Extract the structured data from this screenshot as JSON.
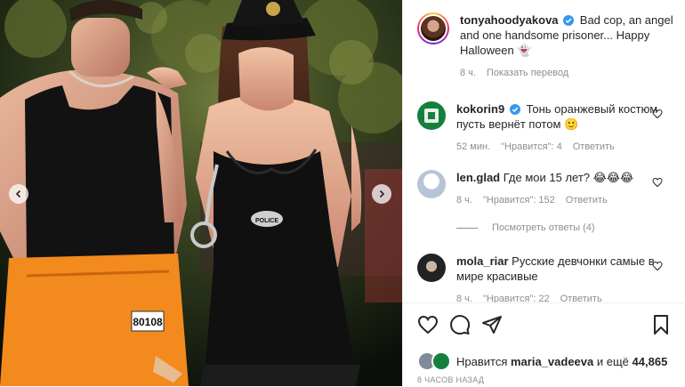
{
  "post": {
    "author": "tonyahoodyakova",
    "caption": "Bad cop, an angel and one handsome prisoner... Happy Halloween",
    "caption_emoji": "👻",
    "age": "8 ч.",
    "translate_label": "Показать перевод"
  },
  "comments": [
    {
      "user": "kokorin9",
      "verified": true,
      "text": "Тонь оранжевый костюм пусть вернёт потом",
      "emoji": "🙂",
      "age": "52 мин.",
      "likes": "\"Нравится\": 4",
      "reply_label": "Ответить"
    },
    {
      "user": "len.glad",
      "verified": false,
      "text": "Где мои 15 лет?",
      "emoji": "😂😂😂",
      "age": "8 ч.",
      "likes": "\"Нравится\": 152",
      "reply_label": "Ответить"
    },
    {
      "user": "mola_riar",
      "verified": false,
      "text": "Русские девчонки самые в мире красивые",
      "emoji": "",
      "age": "8 ч.",
      "likes": "\"Нравится\": 22",
      "reply_label": "Ответить"
    }
  ],
  "view_replies_label": "Посмотреть ответы (4)",
  "likes_bar": {
    "prefix": "Нравится",
    "user": "maria_vadeeva",
    "suffix": "и ещё",
    "count": "44,865"
  },
  "timestamp": "8 ЧАСОВ НАЗАД",
  "photo": {
    "badge_text": "POLICE",
    "prisoner_number": "80108"
  },
  "colors": {
    "accent_blue": "#0095f6",
    "verified_blue": "#3897f0",
    "orange": "#f28a1e",
    "muted": "#8e8e8e"
  },
  "icons": [
    "heart-icon",
    "comment-icon",
    "share-icon",
    "bookmark-icon",
    "chevron-left-icon",
    "chevron-right-icon",
    "verified-icon"
  ]
}
